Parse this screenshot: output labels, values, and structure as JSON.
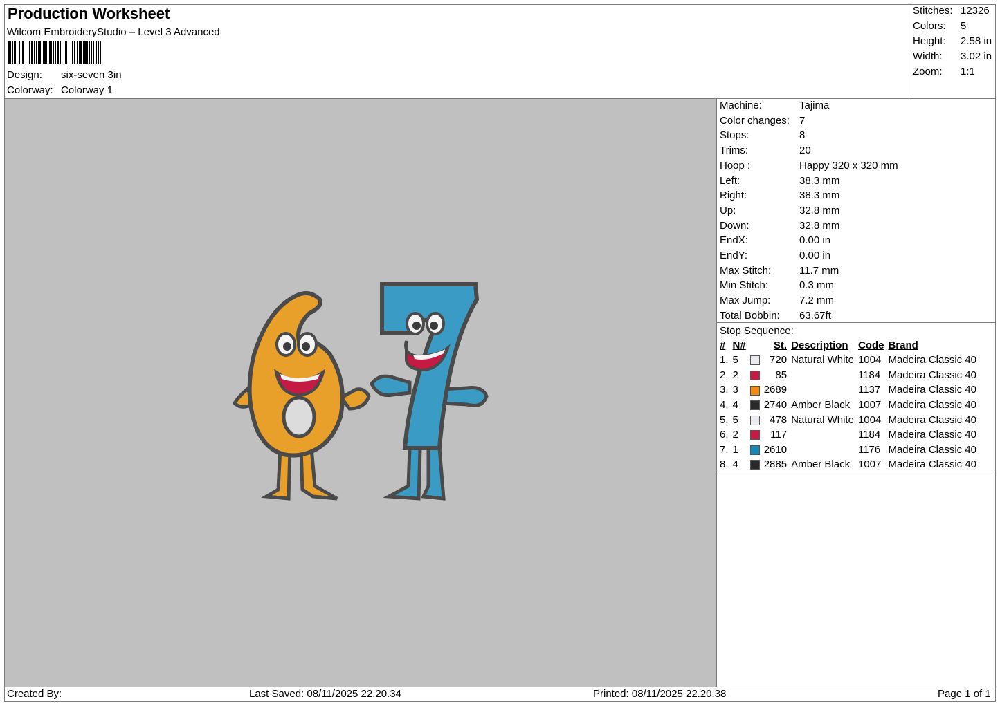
{
  "header": {
    "title": "Production Worksheet",
    "software": "Wilcom EmbroideryStudio – Level 3 Advanced",
    "design_label": "Design:",
    "design_value": "six-seven 3in",
    "colorway_label": "Colorway:",
    "colorway_value": "Colorway 1"
  },
  "stats": [
    {
      "label": "Stitches:",
      "value": "12326"
    },
    {
      "label": "Colors:",
      "value": "5"
    },
    {
      "label": "Height:",
      "value": "2.58 in"
    },
    {
      "label": "Width:",
      "value": "3.02 in"
    },
    {
      "label": "Zoom:",
      "value": "1:1"
    }
  ],
  "machine_info": [
    {
      "label": "Machine:",
      "value": "Tajima"
    },
    {
      "label": "Color changes:",
      "value": "7"
    },
    {
      "label": "Stops:",
      "value": "8"
    },
    {
      "label": "Trims:",
      "value": "20"
    },
    {
      "label": "Hoop :",
      "value": "Happy 320 x 320 mm"
    },
    {
      "label": "Left:",
      "value": "38.3 mm"
    },
    {
      "label": "Right:",
      "value": "38.3 mm"
    },
    {
      "label": "Up:",
      "value": "32.8 mm"
    },
    {
      "label": "Down:",
      "value": "32.8 mm"
    },
    {
      "label": "EndX:",
      "value": "0.00 in"
    },
    {
      "label": "EndY:",
      "value": "0.00 in"
    },
    {
      "label": "Max Stitch:",
      "value": "11.7 mm"
    },
    {
      "label": "Min Stitch:",
      "value": "0.3 mm"
    },
    {
      "label": "Max Jump:",
      "value": "7.2 mm"
    },
    {
      "label": "Total Bobbin:",
      "value": "63.67ft"
    }
  ],
  "stop_sequence": {
    "title": "Stop Sequence:",
    "headers": {
      "num": "#",
      "needle": "N#",
      "stitches": "St.",
      "description": "Description",
      "code": "Code",
      "brand": "Brand"
    },
    "rows": [
      {
        "num": "1.",
        "needle": "5",
        "color": "#eceaf0",
        "stitches": "720",
        "description": "Natural White",
        "code": "1004",
        "brand": "Madeira Classic 40"
      },
      {
        "num": "2.",
        "needle": "2",
        "color": "#c41a44",
        "stitches": "85",
        "description": "",
        "code": "1184",
        "brand": "Madeira Classic 40"
      },
      {
        "num": "3.",
        "needle": "3",
        "color": "#f08c14",
        "stitches": "2689",
        "description": "",
        "code": "1137",
        "brand": "Madeira Classic 40"
      },
      {
        "num": "4.",
        "needle": "4",
        "color": "#2a2a2a",
        "stitches": "2740",
        "description": "Amber Black",
        "code": "1007",
        "brand": "Madeira Classic 40"
      },
      {
        "num": "5.",
        "needle": "5",
        "color": "#eceaf0",
        "stitches": "478",
        "description": "Natural White",
        "code": "1004",
        "brand": "Madeira Classic 40"
      },
      {
        "num": "6.",
        "needle": "2",
        "color": "#c41a44",
        "stitches": "117",
        "description": "",
        "code": "1184",
        "brand": "Madeira Classic 40"
      },
      {
        "num": "7.",
        "needle": "1",
        "color": "#1a86b4",
        "stitches": "2610",
        "description": "",
        "code": "1176",
        "brand": "Madeira Classic 40"
      },
      {
        "num": "8.",
        "needle": "4",
        "color": "#2a2a2a",
        "stitches": "2885",
        "description": "Amber Black",
        "code": "1007",
        "brand": "Madeira Classic 40"
      }
    ]
  },
  "footer": {
    "created_by": "Created By:",
    "last_saved": "Last Saved: 08/11/2025 22.20.34",
    "printed": "Printed: 08/11/2025 22.20.38",
    "page": "Page 1 of 1"
  },
  "colors": {
    "canvas_bg": "#c0c0c0",
    "six_fill": "#e8a02a",
    "seven_fill": "#3a9cc4",
    "outline": "#4a4a4a",
    "mouth": "#c41a44"
  }
}
